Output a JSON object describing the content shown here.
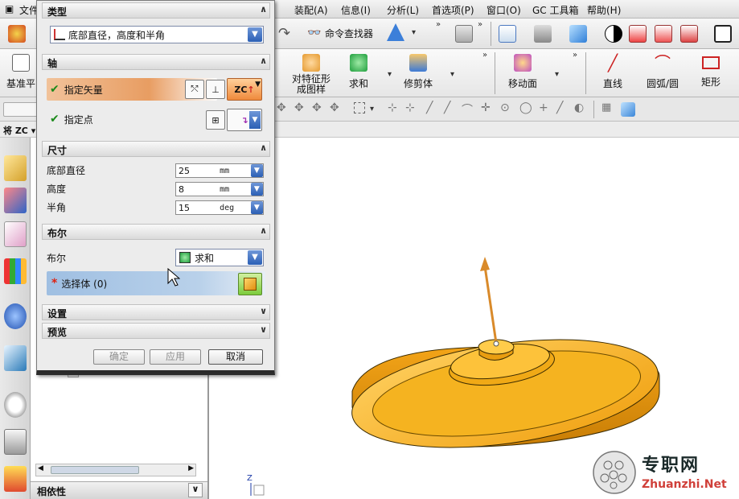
{
  "menubar": {
    "items": [
      "文件",
      "装配(A)",
      "信息(I)",
      "分析(L)",
      "首选项(P)",
      "窗口(O)",
      "GC 工具箱",
      "帮助(H)"
    ]
  },
  "toolbar1": {
    "command_finder_label": "命令查找器"
  },
  "toolbar2": {
    "datum_label": "基准平",
    "pattern_feature_label": "对特征形\n成图样",
    "unite_label": "求和",
    "trim_body_label": "修剪体",
    "move_face_label": "移动面",
    "line_label": "直线",
    "arc_label": "圆弧/圆",
    "rectangle_label": "矩形"
  },
  "toolbar4": {
    "left_text": "将 ZC ▾"
  },
  "dialog": {
    "type_section": {
      "title": "类型",
      "selected": "底部直径，高度和半角"
    },
    "axis_section": {
      "title": "轴",
      "vector_label": "指定矢量",
      "point_label": "指定点",
      "vector_direction": "ZC"
    },
    "dimensions_section": {
      "title": "尺寸",
      "fields": [
        {
          "label": "底部直径",
          "value": "25",
          "unit": "mm"
        },
        {
          "label": "高度",
          "value": "8",
          "unit": "mm"
        },
        {
          "label": "半角",
          "value": "15",
          "unit": "deg"
        }
      ]
    },
    "boolean_section": {
      "title": "布尔",
      "label": "布尔",
      "value": "求和",
      "select_body_label": "选择体 (0)"
    },
    "settings_title": "设置",
    "preview_title": "预览",
    "buttons": {
      "ok": "确定",
      "apply": "应用",
      "cancel": "取消"
    }
  },
  "navigator": {
    "dependency_title": "相依性"
  },
  "watermark": {
    "cn": "专职网",
    "en": "Zhuanzhi.Net"
  },
  "colors": {
    "part_color": "#f5b320",
    "vector_color": "#d98a2a",
    "highlight_orange": "#e89d62",
    "highlight_blue": "#9fbfe2",
    "dropdown_blue": "#2b5fb5"
  }
}
